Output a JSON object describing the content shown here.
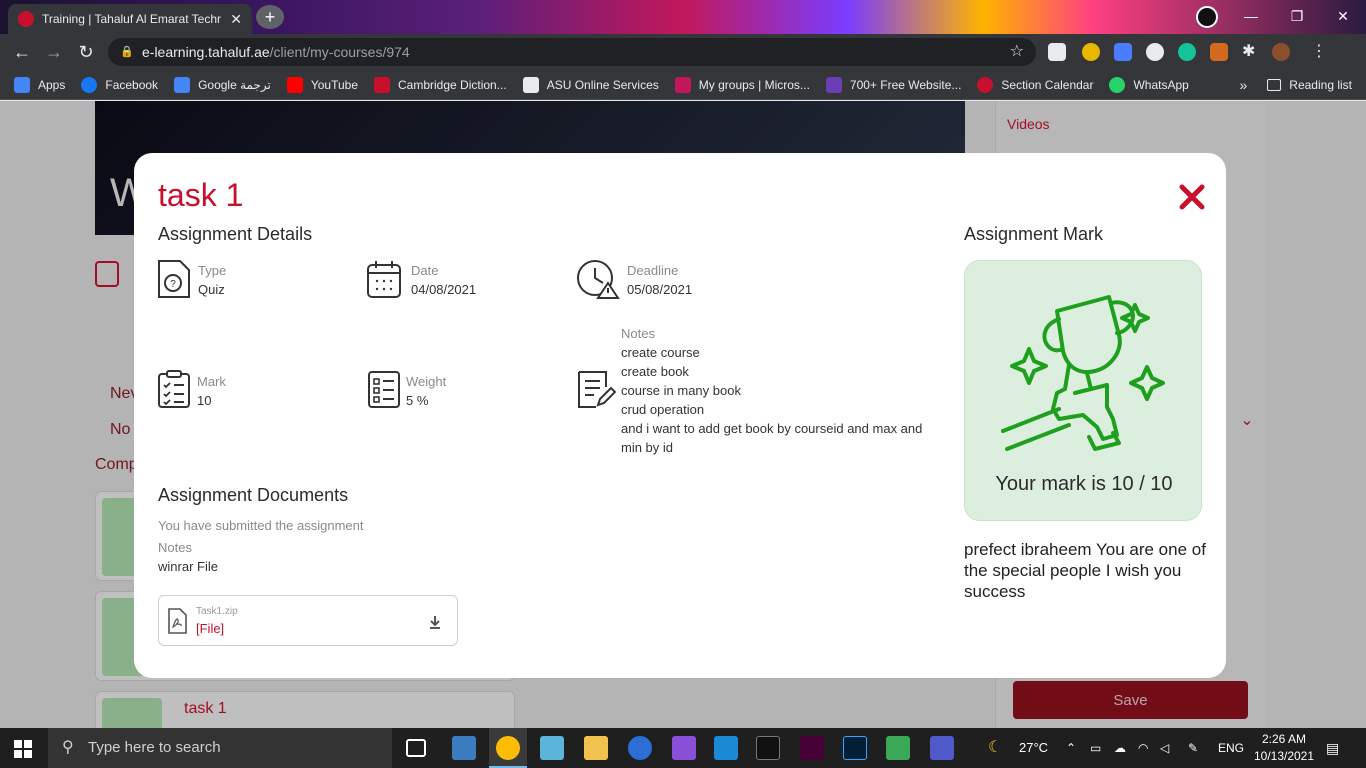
{
  "browser": {
    "tab_title": "Training | Tahaluf Al Emarat Techr",
    "url_host": "e-learning.tahaluf.ae",
    "url_path": "/client/my-courses/974",
    "bookmarks": [
      {
        "label": "Apps",
        "color": "#4285f4"
      },
      {
        "label": "Facebook",
        "color": "#1877f2"
      },
      {
        "label": "Google ترجمة",
        "color": "#4285f4"
      },
      {
        "label": "YouTube",
        "color": "#ff0000"
      },
      {
        "label": "Cambridge Diction...",
        "color": "#c8102e"
      },
      {
        "label": "ASU Online Services",
        "color": "#e8eaed"
      },
      {
        "label": "My groups | Micros...",
        "color": "#c2185b"
      },
      {
        "label": "700+ Free Website...",
        "color": "#6a3fb5"
      },
      {
        "label": "Section Calendar",
        "color": "#c8102e"
      },
      {
        "label": "WhatsApp",
        "color": "#25d366"
      }
    ],
    "overflow": "»",
    "reading_list": "Reading list"
  },
  "background": {
    "hero_letter": "W",
    "videos": "Videos",
    "side_new": "Nev",
    "side_no": "No",
    "side_comp": "Comp",
    "bg_task": "task 1",
    "save": "Save"
  },
  "modal": {
    "title": "task 1",
    "details_heading": "Assignment Details",
    "type_label": "Type",
    "type_value": "Quiz",
    "date_label": "Date",
    "date_value": "04/08/2021",
    "deadline_label": "Deadline",
    "deadline_value": "05/08/2021",
    "mark_label": "Mark",
    "mark_value": "10",
    "weight_label": "Weight",
    "weight_value": "5 %",
    "notes_label": "Notes",
    "notes_lines": [
      "create course",
      "create book",
      "course in many book",
      "crud operation",
      "and i want to add get book by courseid and max and min by id"
    ],
    "documents_heading": "Assignment Documents",
    "submitted_text": "You have submitted the assignment",
    "doc_notes_label": "Notes",
    "doc_notes_value": "winrar File",
    "file_name": "Task1.zip",
    "file_link": "[File]",
    "mark_heading": "Assignment Mark",
    "mark_result": "Your mark is 10 / 10",
    "mark_message": "prefect ibraheem You are one of the special people I wish you success",
    "accent_color": "#c8102e",
    "success_color": "#1ea01e"
  },
  "taskbar": {
    "search_placeholder": "Type here to search",
    "weather": "27°C",
    "language": "ENG",
    "time": "2:26 AM",
    "date": "10/13/2021"
  }
}
